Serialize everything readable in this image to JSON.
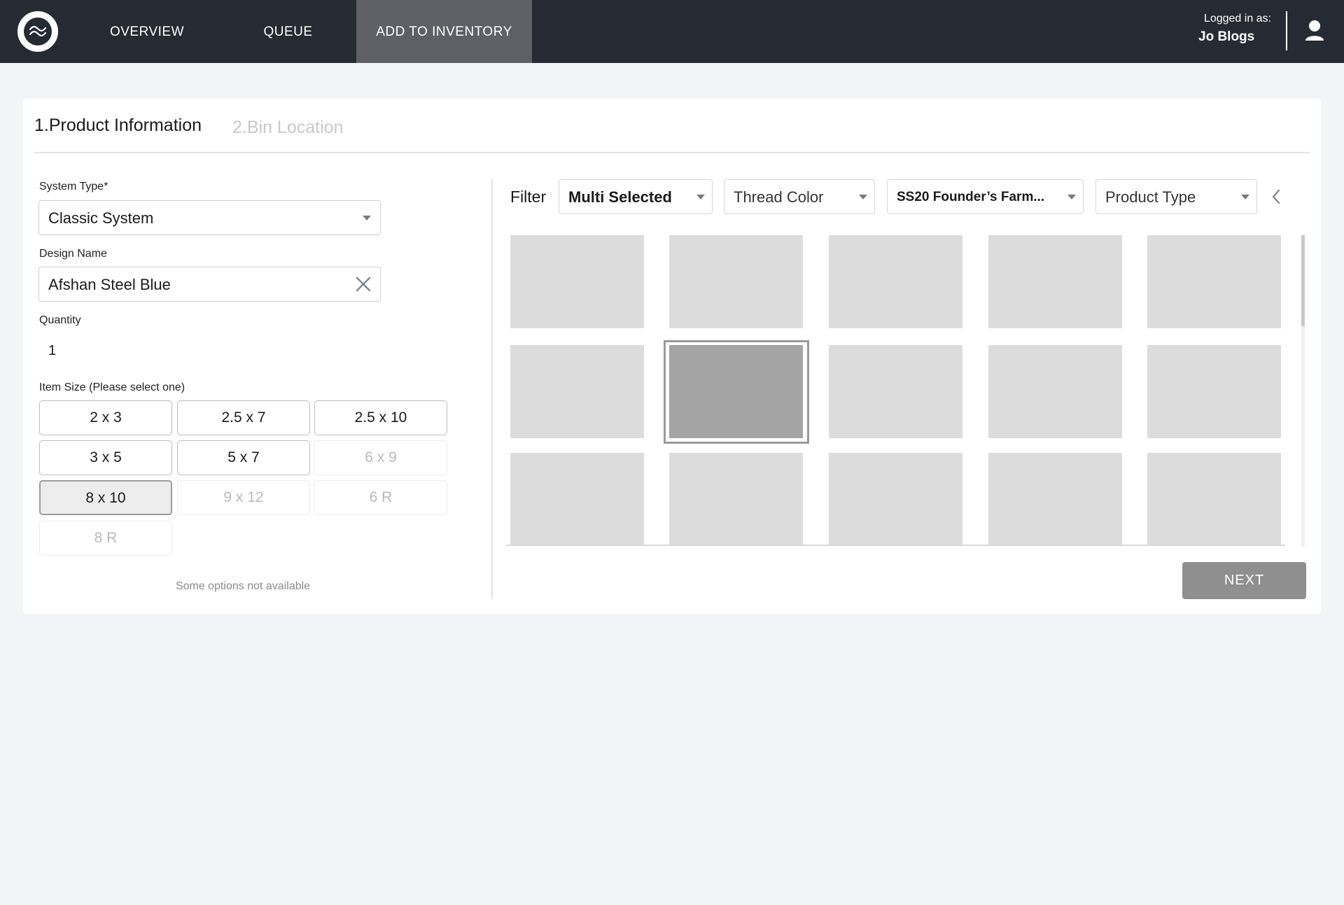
{
  "nav": {
    "items": [
      {
        "label": "OVERVIEW"
      },
      {
        "label": "QUEUE"
      },
      {
        "label": "ADD TO INVENTORY"
      }
    ],
    "active_index": 2,
    "user": {
      "logged_in_label": "Logged in as:",
      "name": "Jo Blogs"
    }
  },
  "steps": {
    "active": "1.Product Information",
    "next": "2.Bin Location"
  },
  "form": {
    "system_type": {
      "label": "System Type*",
      "value": "Classic System"
    },
    "design_name": {
      "label": "Design Name",
      "value": "Afshan Steel Blue"
    },
    "quantity": {
      "label": "Quantity",
      "value": "1"
    },
    "item_size": {
      "label": "Item Size (Please select one)",
      "options": [
        {
          "label": "2 x 3",
          "state": "available"
        },
        {
          "label": "2.5 x 7",
          "state": "available"
        },
        {
          "label": "2.5 x 10",
          "state": "available"
        },
        {
          "label": "3 x 5",
          "state": "available"
        },
        {
          "label": "5 x 7",
          "state": "available"
        },
        {
          "label": "6 x 9",
          "state": "disabled"
        },
        {
          "label": "8 x 10",
          "state": "selected"
        },
        {
          "label": "9 x 12",
          "state": "disabled"
        },
        {
          "label": "6 R",
          "state": "disabled"
        },
        {
          "label": "8 R",
          "state": "disabled"
        }
      ],
      "note": "Some options not available"
    }
  },
  "filters": {
    "label": "Filter",
    "dropdowns": [
      {
        "value": "Multi Selected"
      },
      {
        "value": "Thread Color"
      },
      {
        "value": "SS20 Founder’s Farm..."
      },
      {
        "value": "Product Type"
      }
    ]
  },
  "grid": {
    "rows": 3,
    "columns": 5,
    "selected_tile": {
      "row": 2,
      "column": 2
    }
  },
  "actions": {
    "next_label": "NEXT"
  }
}
